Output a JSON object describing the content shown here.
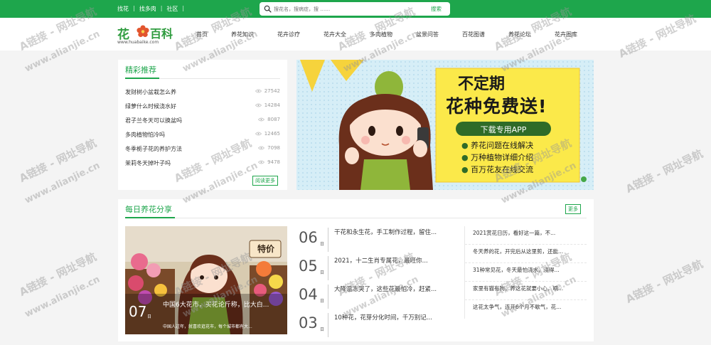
{
  "top_links": [
    "找花",
    "找多肉",
    "社区"
  ],
  "top_sep": "|",
  "search": {
    "placeholder": "搜花名，搜病症，搜 ……",
    "button": "搜索"
  },
  "logo": {
    "text1": "花",
    "text2": "百科",
    "url": "www.huabaike.com"
  },
  "nav": [
    "首页",
    "养花知识",
    "花卉诊疗",
    "花卉大全",
    "多肉植物",
    "盆景问答",
    "百花图谱",
    "养花论坛",
    "花卉图库"
  ],
  "hot": {
    "title": "精彩推荐",
    "items": [
      {
        "title": "发财树小盆栽怎么养",
        "count": "27542"
      },
      {
        "title": "绿萝什么时候浇水好",
        "count": "14284"
      },
      {
        "title": "君子兰冬天可以换盆吗",
        "count": "8087"
      },
      {
        "title": "多肉植物怕冷吗",
        "count": "12465"
      },
      {
        "title": "冬季栀子花的养护方法",
        "count": "7098"
      },
      {
        "title": "茉莉冬天掉叶子吗",
        "count": "9478"
      }
    ],
    "more": "阅读更多"
  },
  "banner": {
    "line1": "不定期",
    "line2": "花种免费送!",
    "pill": "下载专用APP",
    "bullets": [
      "养花问题在线解决",
      "万种植物详细介绍",
      "百万花友在线交流"
    ]
  },
  "daily": {
    "title": "每日养花分享",
    "more": "更多",
    "feature": {
      "day": "07",
      "ri": "日",
      "title": "中国6大花市，买花论斤称，比大白...",
      "desc": "中国人过年，就喜欢逛花市，每个城市都有大...",
      "sign": "特价"
    },
    "dated": [
      {
        "day": "06",
        "ri": "日",
        "title": "干花和永生花，手工制作过程，留住..."
      },
      {
        "day": "05",
        "ri": "日",
        "title": "2021，十二生肖专属花，最旺你..."
      },
      {
        "day": "04",
        "ri": "日",
        "title": "大降温冻哭了，这些花最怕冷，赶紧..."
      },
      {
        "day": "03",
        "ri": "日",
        "title": "10种花，花芽分化时间，千万别记..."
      }
    ],
    "right_list": [
      "2021赏花日历，看好这一篇，不...",
      "冬天养的花，开完后从这里剪，还能...",
      "31种常见花，冬天最怕浇水，浇得...",
      "家里有猫有狗，养这花就要小心，嘀...",
      "这花太争气，连开6个月不歇气，花..."
    ]
  },
  "watermark": {
    "a": "A链接 - 网址导航",
    "b": "www.alianjie.cn"
  },
  "colors": {
    "brand_green": "#1ea64c",
    "banner_yellow": "#fbe94a"
  }
}
